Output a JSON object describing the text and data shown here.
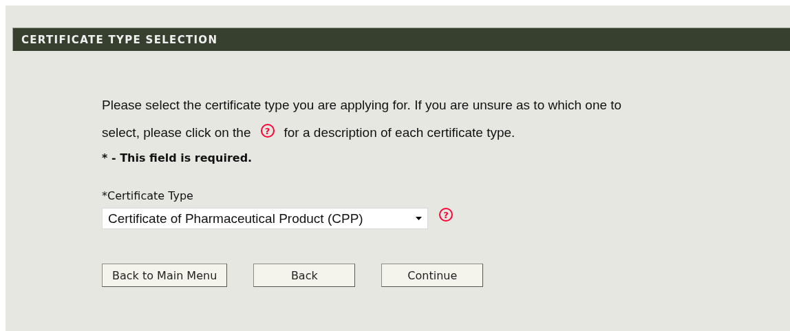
{
  "header": {
    "title": "CERTIFICATE TYPE SELECTION"
  },
  "intro": {
    "first_line": "Please select the certificate type you are applying for. If you are unsure as to which one to",
    "before_help": "select, please click on the",
    "help_icon": "?",
    "after_help": "for a description of each certificate type."
  },
  "required_note": "* - This field is required.",
  "certificate_type": {
    "label": "*Certificate Type",
    "value": "Certificate of Pharmaceutical Product (CPP)",
    "help_icon": "?"
  },
  "buttons": [
    {
      "label": "Back to Main Menu"
    },
    {
      "label": "Back"
    },
    {
      "label": "Continue"
    }
  ]
}
